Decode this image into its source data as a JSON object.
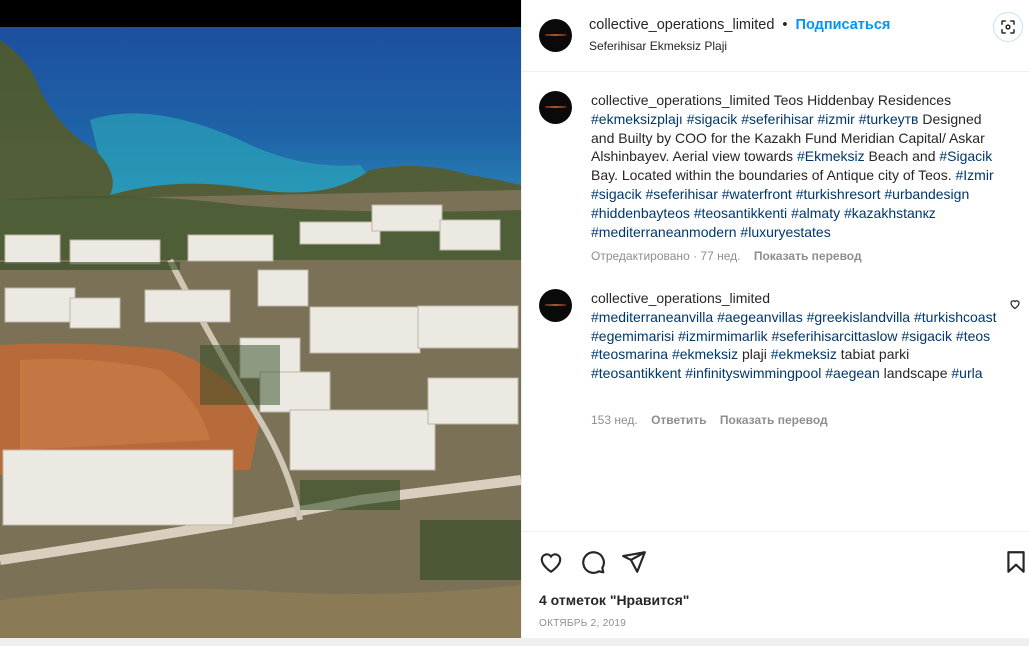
{
  "post": {
    "username": "collective_operations_limited",
    "separator": "•",
    "follow_label": "Подписаться",
    "location": "Seferihisar Ekmeksiz Plaji"
  },
  "caption": {
    "username": "collective_operations_limited",
    "segments": [
      {
        "t": "Teos Hiddenbay Residences ",
        "tag": false
      },
      {
        "t": "#ekmeksizplajı",
        "tag": true
      },
      {
        "t": " ",
        "tag": false
      },
      {
        "t": "#sigacik",
        "tag": true
      },
      {
        "t": " ",
        "tag": false
      },
      {
        "t": "#seferihisar",
        "tag": true
      },
      {
        "t": " ",
        "tag": false
      },
      {
        "t": "#izmir",
        "tag": true
      },
      {
        "t": " ",
        "tag": false
      },
      {
        "t": "#turkeyтв",
        "tag": true
      },
      {
        "t": " Designed and Builty by COO for the Kazakh Fund Meridian Capital/ Askar Alshinbayev. Aerial view towards ",
        "tag": false
      },
      {
        "t": "#Ekmeksiz",
        "tag": true
      },
      {
        "t": " Beach and ",
        "tag": false
      },
      {
        "t": "#Sigacik",
        "tag": true
      },
      {
        "t": " Bay. Located within the boundaries of Antique city of Teos. ",
        "tag": false
      },
      {
        "t": "#Izmir",
        "tag": true
      },
      {
        "t": " ",
        "tag": false
      },
      {
        "t": "#sigacik",
        "tag": true
      },
      {
        "t": " ",
        "tag": false
      },
      {
        "t": "#seferihisar",
        "tag": true
      },
      {
        "t": " ",
        "tag": false
      },
      {
        "t": "#waterfront",
        "tag": true
      },
      {
        "t": " ",
        "tag": false
      },
      {
        "t": "#turkishresort",
        "tag": true
      },
      {
        "t": " ",
        "tag": false
      },
      {
        "t": "#urbandesign",
        "tag": true
      },
      {
        "t": " ",
        "tag": false
      },
      {
        "t": "#hiddenbayteos",
        "tag": true
      },
      {
        "t": " ",
        "tag": false
      },
      {
        "t": "#teosantikkenti",
        "tag": true
      },
      {
        "t": " ",
        "tag": false
      },
      {
        "t": "#almaty",
        "tag": true
      },
      {
        "t": " ",
        "tag": false
      },
      {
        "t": "#kazakhstanкz",
        "tag": true
      },
      {
        "t": " ",
        "tag": false
      },
      {
        "t": "#mediterraneanmodern",
        "tag": true
      },
      {
        "t": " ",
        "tag": false
      },
      {
        "t": "#luxuryestates",
        "tag": true
      }
    ],
    "meta_time": "Отредактировано · 77 нед.",
    "translate_label": "Показать перевод"
  },
  "comment": {
    "username": "collective_operations_limited",
    "segments": [
      {
        "t": "#mediterraneanvilla",
        "tag": true
      },
      {
        "t": " ",
        "tag": false
      },
      {
        "t": "#aegeanvillas",
        "tag": true
      },
      {
        "t": " ",
        "tag": false
      },
      {
        "t": "#greekislandvilla",
        "tag": true
      },
      {
        "t": " ",
        "tag": false
      },
      {
        "t": "#turkishcoast",
        "tag": true
      },
      {
        "t": " ",
        "tag": false
      },
      {
        "t": "#egemimarisi",
        "tag": true
      },
      {
        "t": " ",
        "tag": false
      },
      {
        "t": "#izmirmimarlik",
        "tag": true
      },
      {
        "t": " ",
        "tag": false
      },
      {
        "t": "#seferihisarcittaslow",
        "tag": true
      },
      {
        "t": " ",
        "tag": false
      },
      {
        "t": "#sigacik",
        "tag": true
      },
      {
        "t": " ",
        "tag": false
      },
      {
        "t": "#teos",
        "tag": true
      },
      {
        "t": " ",
        "tag": false
      },
      {
        "t": "#teosmarina",
        "tag": true
      },
      {
        "t": " ",
        "tag": false
      },
      {
        "t": "#ekmeksiz",
        "tag": true
      },
      {
        "t": " plaji ",
        "tag": false
      },
      {
        "t": "#ekmeksiz",
        "tag": true
      },
      {
        "t": " tabiat parki ",
        "tag": false
      },
      {
        "t": "#teosantikkent",
        "tag": true
      },
      {
        "t": " ",
        "tag": false
      },
      {
        "t": "#infinityswimmingpool",
        "tag": true
      },
      {
        "t": " ",
        "tag": false
      },
      {
        "t": "#aegean",
        "tag": true
      },
      {
        "t": " landscape ",
        "tag": false
      },
      {
        "t": "#urla",
        "tag": true
      }
    ],
    "meta_time": "153 нед.",
    "reply_label": "Ответить",
    "translate_label": "Показать перевод"
  },
  "footer": {
    "likes": "4 отметок \"Нравится\"",
    "date": "ОКТЯБРЬ 2, 2019"
  },
  "icons": {
    "like": "heart-icon",
    "comment": "comment-bubble-icon",
    "share": "paper-plane-icon",
    "save": "bookmark-icon",
    "comment_like": "heart-icon",
    "header": "qr-scan-icon"
  },
  "colors": {
    "hashtag": "#00376b",
    "follow": "#0095f6",
    "meta": "#8e8e8e"
  }
}
